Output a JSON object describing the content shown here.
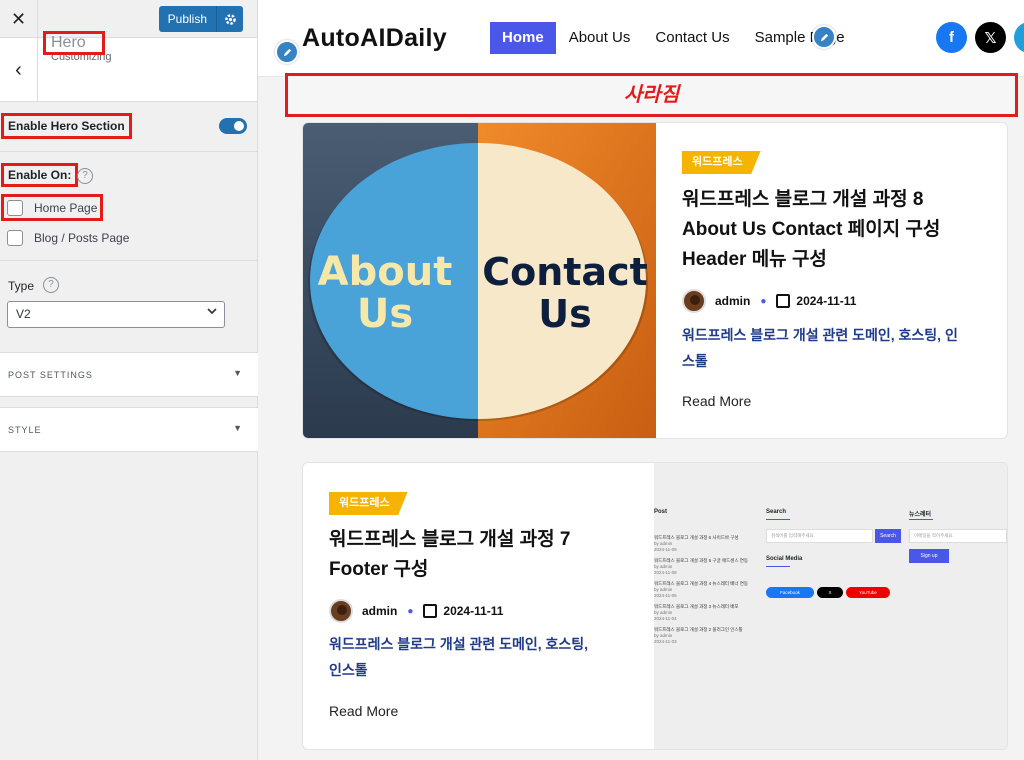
{
  "panel": {
    "close_icon": "close-icon",
    "publish_label": "Publish",
    "crumb": "Customizing",
    "section_title": "Hero",
    "enable_hero_label": "Enable Hero Section",
    "enable_hero_on": true,
    "enable_on_label": "Enable On:",
    "checkboxes": [
      {
        "label": "Home Page",
        "checked": false
      },
      {
        "label": "Blog / Posts Page",
        "checked": false
      }
    ],
    "type_label": "Type",
    "type_value": "V2",
    "accordions": [
      "POST SETTINGS",
      "STYLE"
    ],
    "highlight_color": "#e21b1b",
    "accent_color": "#2271b1"
  },
  "site": {
    "logo": "AutoAIDaily",
    "nav": [
      "Home",
      "About Us",
      "Contact Us",
      "Sample Page"
    ],
    "nav_active": "Home",
    "social": [
      {
        "icon": "facebook-icon",
        "glyph": "f",
        "color": "#1877f2"
      },
      {
        "icon": "x-icon",
        "glyph": "𝕏",
        "color": "#000000"
      },
      {
        "icon": "telegram-icon",
        "glyph": "",
        "color": "#229ed9"
      }
    ],
    "banner_text": "사라짐"
  },
  "posts": [
    {
      "category": "워드프레스",
      "title_lines": [
        "워드프레스 블로그 개설 과정 8",
        "About Us Contact 페이지 구성",
        "Header 메뉴 구성"
      ],
      "author": "admin",
      "date": "2024-11-11",
      "excerpt_lines": [
        "워드프레스 블로그 개설 관련 도메인, 호스팅, 인",
        "스톨"
      ],
      "read_more": "Read More",
      "thumb_left": "About Us",
      "thumb_right": "Contact Us"
    },
    {
      "category": "워드프레스",
      "title_lines": [
        "워드프레스 블로그 개설 과정 7",
        "Footer 구성"
      ],
      "author": "admin",
      "date": "2024-11-11",
      "excerpt_lines": [
        "워드프레스 블로그 개설 관련 도메인, 호스팅,",
        "인스톨"
      ],
      "read_more": "Read More"
    }
  ],
  "footer_thumb": {
    "col_post": "Post",
    "col_search": "Search",
    "col_news": "뉴스레터",
    "search_placeholder": "검색어를 입력해주세요.",
    "search_btn": "Search",
    "email_placeholder": "이메일을 적어주세요.",
    "signup": "Sign up",
    "social_media": "Social Media",
    "social_btns": [
      "Facebook",
      "X",
      "YouTube"
    ],
    "post_items": [
      {
        "title": "워드프레스 블로그 개설 과정 6 사이드바 구성",
        "author": "by admin",
        "date": "2024-11-09"
      },
      {
        "title": "워드프레스 블로그 개설 과정 5 구글 애드센스 연동",
        "author": "by admin",
        "date": "2024-11-08"
      },
      {
        "title": "워드프레스 블로그 개설 과정 4 뉴스레터 배너 연동",
        "author": "by admin",
        "date": "2024-11-06"
      },
      {
        "title": "워드프레스 블로그 개설 과정 3 뉴스레터 배포",
        "author": "by admin",
        "date": "2024-11-04"
      },
      {
        "title": "워드프레스 블로그 개설 과정 2 플러그인 인스톨",
        "author": "by admin",
        "date": "2024-11-03"
      }
    ]
  }
}
